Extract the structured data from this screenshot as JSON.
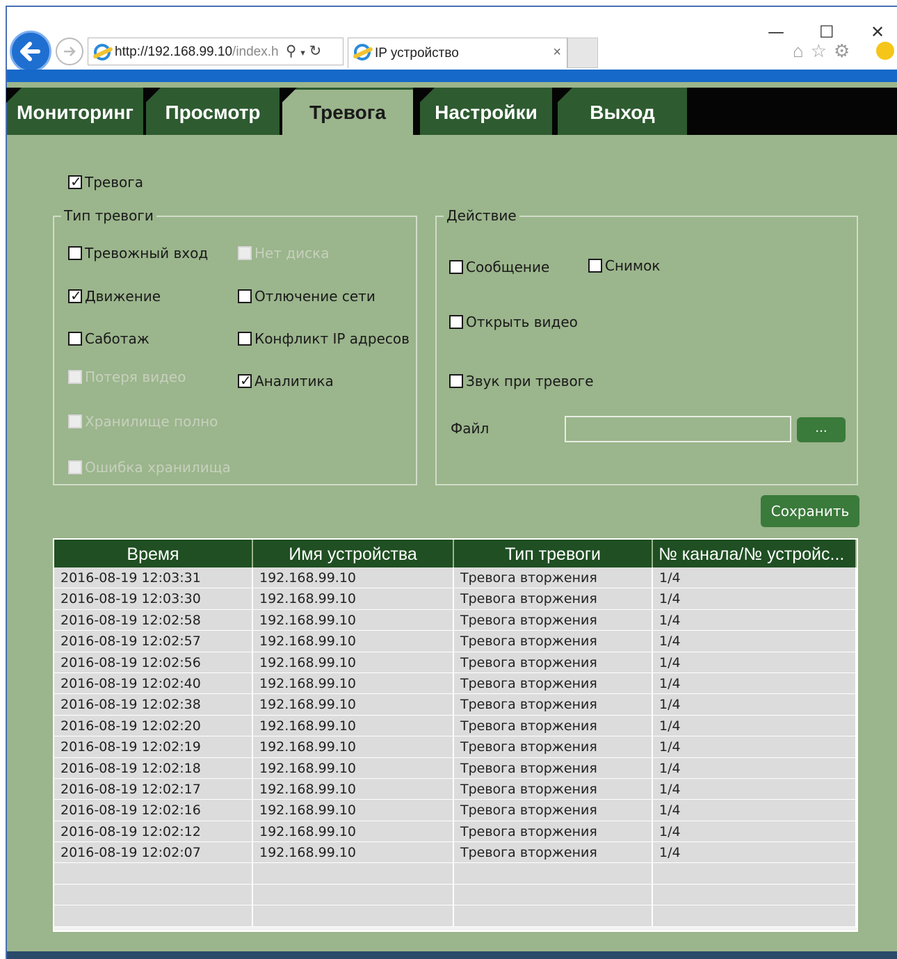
{
  "browser": {
    "window_controls": {
      "minimize": "—",
      "maximize": "☐",
      "close": "✕"
    },
    "url_main": "http://192.168.99.10",
    "url_rest": "/index.h",
    "tab_title": "IP устройство",
    "tab_close": "×"
  },
  "nav": {
    "tabs": [
      {
        "label": "Мониторинг",
        "active": false
      },
      {
        "label": "Просмотр",
        "active": false
      },
      {
        "label": "Тревога",
        "active": true
      },
      {
        "label": "Настройки",
        "active": false
      },
      {
        "label": "Выход",
        "active": false
      }
    ]
  },
  "alarm": {
    "enabled_label": "Тревога",
    "enabled": true,
    "type_legend": "Тип тревоги",
    "types": {
      "alarm_input": {
        "label": "Тревожный вход",
        "checked": false,
        "disabled": false
      },
      "no_disk": {
        "label": "Нет диска",
        "checked": false,
        "disabled": true
      },
      "motion": {
        "label": "Движение",
        "checked": true,
        "disabled": false
      },
      "network_off": {
        "label": "Отлючение сети",
        "checked": false,
        "disabled": false
      },
      "tamper": {
        "label": "Саботаж",
        "checked": false,
        "disabled": false
      },
      "ip_conflict": {
        "label": "Конфликт IP адресов",
        "checked": false,
        "disabled": false
      },
      "video_loss": {
        "label": "Потеря видео",
        "checked": false,
        "disabled": true
      },
      "analytics": {
        "label": "Аналитика",
        "checked": true,
        "disabled": false
      },
      "storage_full": {
        "label": "Хранилище полно",
        "checked": false,
        "disabled": true
      },
      "storage_error": {
        "label": "Ошибка хранилища",
        "checked": false,
        "disabled": true
      }
    },
    "action_legend": "Действие",
    "actions": {
      "message": {
        "label": "Сообщение",
        "checked": false
      },
      "snapshot": {
        "label": "Снимок",
        "checked": false
      },
      "open_video": {
        "label": "Открыть видео",
        "checked": false
      },
      "sound": {
        "label": "Звук при тревоге",
        "checked": false
      }
    },
    "file_label": "Файл",
    "file_value": "",
    "browse_label": "...",
    "save_label": "Сохранить"
  },
  "log_table": {
    "columns": [
      "Время",
      "Имя устройства",
      "Тип тревоги",
      "№ канала/№ устройс..."
    ],
    "rows": [
      [
        "2016-08-19 12:03:31",
        "192.168.99.10",
        "Тревога вторжения",
        "1/4"
      ],
      [
        "2016-08-19 12:03:30",
        "192.168.99.10",
        "Тревога вторжения",
        "1/4"
      ],
      [
        "2016-08-19 12:02:58",
        "192.168.99.10",
        "Тревога вторжения",
        "1/4"
      ],
      [
        "2016-08-19 12:02:57",
        "192.168.99.10",
        "Тревога вторжения",
        "1/4"
      ],
      [
        "2016-08-19 12:02:56",
        "192.168.99.10",
        "Тревога вторжения",
        "1/4"
      ],
      [
        "2016-08-19 12:02:40",
        "192.168.99.10",
        "Тревога вторжения",
        "1/4"
      ],
      [
        "2016-08-19 12:02:38",
        "192.168.99.10",
        "Тревога вторжения",
        "1/4"
      ],
      [
        "2016-08-19 12:02:20",
        "192.168.99.10",
        "Тревога вторжения",
        "1/4"
      ],
      [
        "2016-08-19 12:02:19",
        "192.168.99.10",
        "Тревога вторжения",
        "1/4"
      ],
      [
        "2016-08-19 12:02:18",
        "192.168.99.10",
        "Тревога вторжения",
        "1/4"
      ],
      [
        "2016-08-19 12:02:17",
        "192.168.99.10",
        "Тревога вторжения",
        "1/4"
      ],
      [
        "2016-08-19 12:02:16",
        "192.168.99.10",
        "Тревога вторжения",
        "1/4"
      ],
      [
        "2016-08-19 12:02:12",
        "192.168.99.10",
        "Тревога вторжения",
        "1/4"
      ],
      [
        "2016-08-19 12:02:07",
        "192.168.99.10",
        "Тревога вторжения",
        "1/4"
      ],
      [
        "",
        "",
        "",
        ""
      ],
      [
        "",
        "",
        "",
        ""
      ],
      [
        "",
        "",
        "",
        ""
      ]
    ]
  },
  "colors": {
    "app_background": "#9bb58c",
    "nav_tab": "#2e5b30",
    "table_header": "#1f4f22",
    "button": "#3a7a3a",
    "browser_accent": "#1669c9"
  }
}
